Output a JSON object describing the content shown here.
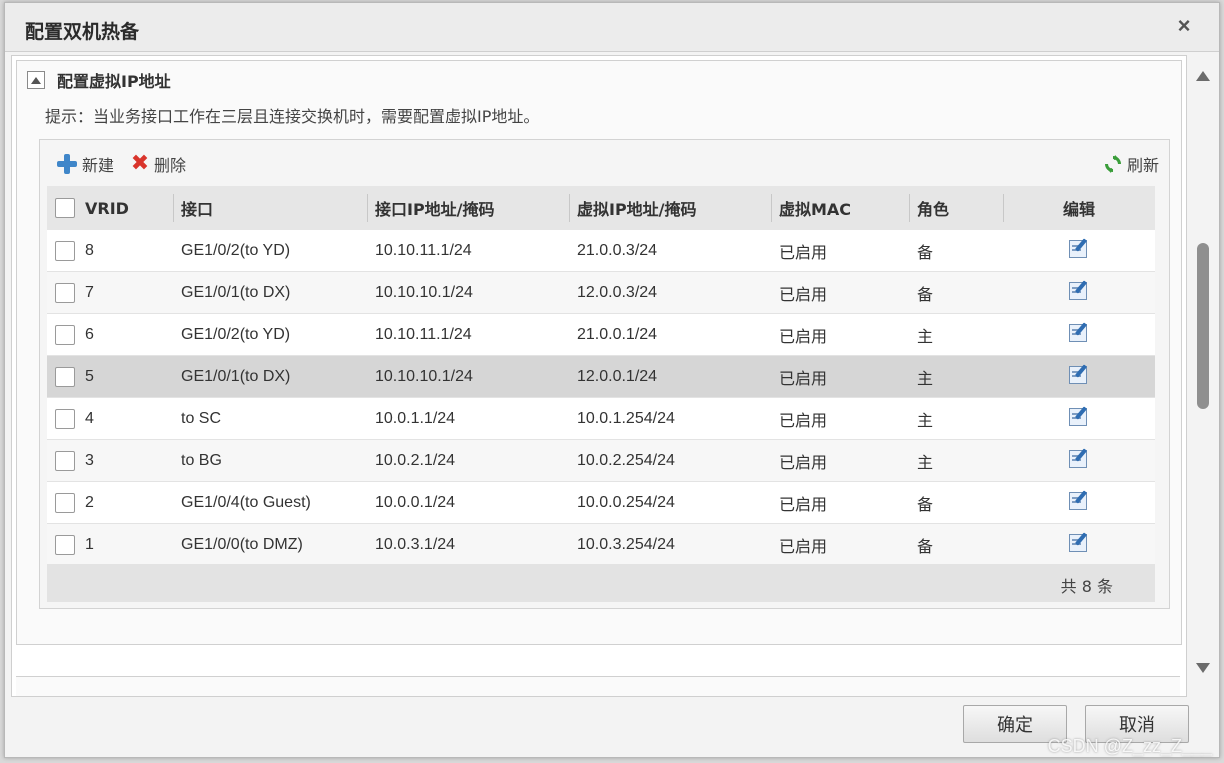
{
  "dialog": {
    "title": "配置双机热备",
    "close_glyph": "×"
  },
  "section": {
    "title": "配置虚拟IP地址",
    "hint": "提示：当业务接口工作在三层且连接交换机时，需要配置虚拟IP地址。"
  },
  "toolbar": {
    "new_label": "新建",
    "delete_label": "删除",
    "refresh_label": "刷新"
  },
  "table": {
    "headers": [
      "VRID",
      "接口",
      "接口IP地址/掩码",
      "虚拟IP地址/掩码",
      "虚拟MAC",
      "角色",
      "编辑"
    ],
    "rows": [
      {
        "vrid": "8",
        "iface": "GE1/0/2(to YD)",
        "ip": "10.10.11.1/24",
        "vip": "21.0.0.3/24",
        "mac": "已启用",
        "role": "备"
      },
      {
        "vrid": "7",
        "iface": "GE1/0/1(to DX)",
        "ip": "10.10.10.1/24",
        "vip": "12.0.0.3/24",
        "mac": "已启用",
        "role": "备"
      },
      {
        "vrid": "6",
        "iface": "GE1/0/2(to YD)",
        "ip": "10.10.11.1/24",
        "vip": "21.0.0.1/24",
        "mac": "已启用",
        "role": "主"
      },
      {
        "vrid": "5",
        "iface": "GE1/0/1(to DX)",
        "ip": "10.10.10.1/24",
        "vip": "12.0.0.1/24",
        "mac": "已启用",
        "role": "主"
      },
      {
        "vrid": "4",
        "iface": "to SC",
        "ip": "10.0.1.1/24",
        "vip": "10.0.1.254/24",
        "mac": "已启用",
        "role": "主"
      },
      {
        "vrid": "3",
        "iface": "to BG",
        "ip": "10.0.2.1/24",
        "vip": "10.0.2.254/24",
        "mac": "已启用",
        "role": "主"
      },
      {
        "vrid": "2",
        "iface": "GE1/0/4(to Guest)",
        "ip": "10.0.0.1/24",
        "vip": "10.0.0.254/24",
        "mac": "已启用",
        "role": "备"
      },
      {
        "vrid": "1",
        "iface": "GE1/0/0(to DMZ)",
        "ip": "10.0.3.1/24",
        "vip": "10.0.3.254/24",
        "mac": "已启用",
        "role": "备"
      }
    ],
    "selected_vrid": "5",
    "total": "共 8 条"
  },
  "buttons": {
    "ok": "确定",
    "cancel": "取消"
  },
  "watermark": "CSDN @Z_zz_Z___",
  "colors": {
    "accent_blue": "#3f86c9",
    "delete_red": "#d9342b",
    "refresh_green": "#3a9d3a",
    "selected_row": "#d6d6d6"
  }
}
